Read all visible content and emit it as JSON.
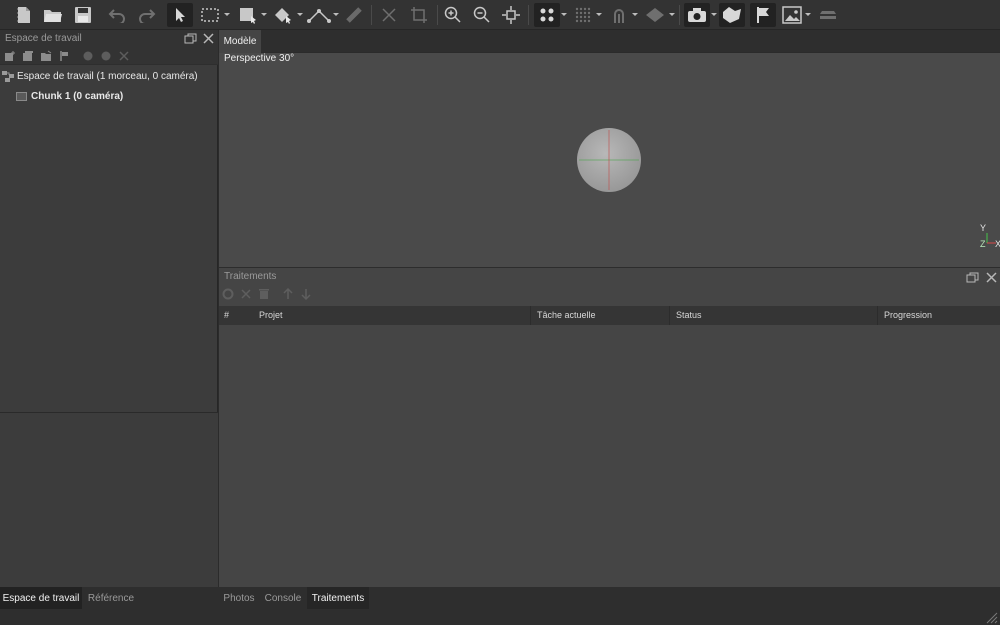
{
  "toolbar": {
    "icons": [
      "handle-icon",
      "new-file-icon",
      "open-folder-icon",
      "save-icon",
      "undo-icon",
      "redo-icon",
      "navigation-arrow-icon",
      "rectangle-selection-icon",
      "resize-region-icon",
      "rotate-object-icon",
      "ruler-icon",
      "ruler-measure-icon",
      "delete-icon",
      "crop-icon",
      "zoom-in-icon",
      "zoom-out-icon",
      "reset-view-icon",
      "show-points-icon",
      "show-dense-cloud-icon",
      "show-model-icon",
      "show-tiled-icon",
      "show-cameras-icon",
      "show-shapes-icon",
      "show-markers-icon",
      "show-images-icon",
      "show-layers-icon"
    ]
  },
  "workspace": {
    "title": "Espace de travail",
    "root_label": "Espace de travail (1 morceau, 0 caméra)",
    "chunk_label": "Chunk 1 (0 caméra)"
  },
  "model": {
    "tab_label": "Modèle",
    "perspective_label": "Perspective 30°",
    "axis_y": "Y",
    "axis_z": "Z",
    "axis_x": "X"
  },
  "processing": {
    "title": "Traitements",
    "columns": [
      "#",
      "Projet",
      "Tâche actuelle",
      "Status",
      "Progression"
    ],
    "rows": []
  },
  "bottom_tabs_left": [
    "Espace de travail",
    "Référence"
  ],
  "bottom_tabs_right": [
    "Photos",
    "Console",
    "Traitements"
  ],
  "colors": {
    "background": "#2b2b2b",
    "panel": "#3c3c3c",
    "viewport": "#4a4a4a",
    "accent_red": "#d64b4b",
    "accent_green": "#45c24a"
  }
}
